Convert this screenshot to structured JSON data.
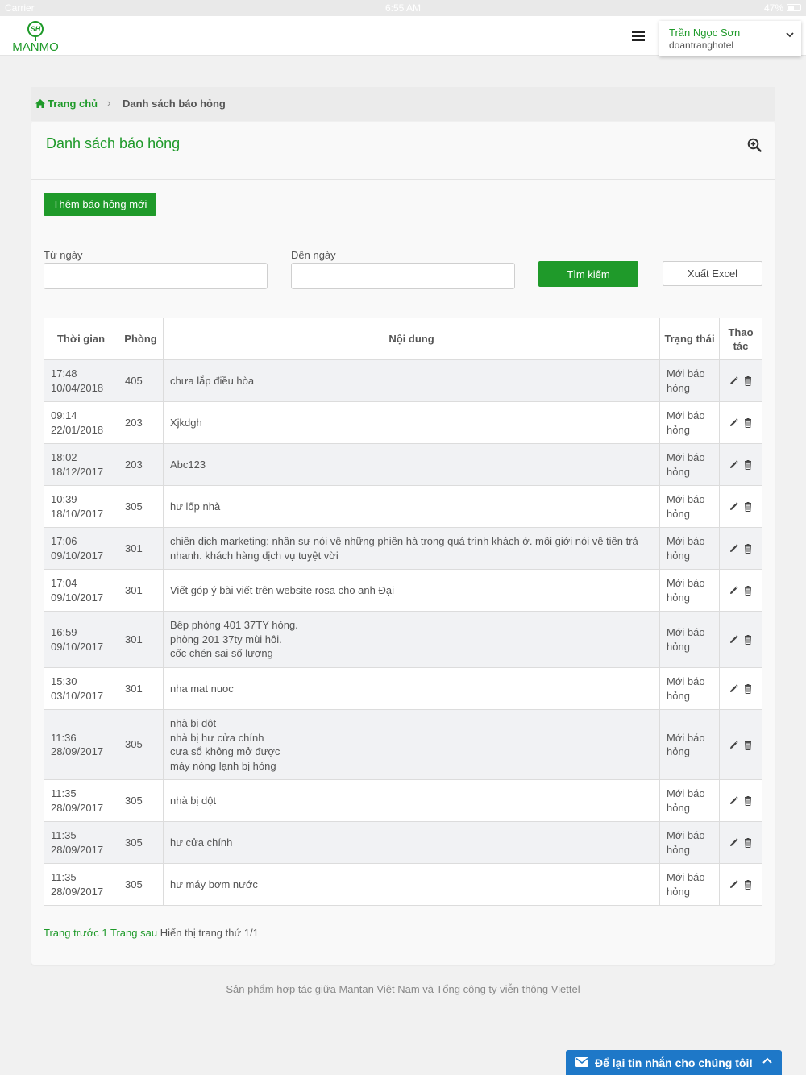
{
  "statusbar": {
    "carrier": "Carrier",
    "time": "6:55 AM",
    "battery": "47%"
  },
  "header": {
    "logo_text": "MANMO",
    "logo_mark": "SH",
    "user_name": "Trần Ngọc Sơn",
    "user_account": "doantranghotel"
  },
  "breadcrumb": {
    "home": "Trang chủ",
    "separator": "›",
    "current": "Danh sách báo hỏng"
  },
  "page": {
    "title": "Danh sách báo hỏng"
  },
  "toolbar": {
    "add_label": "Thêm báo hỏng mới"
  },
  "filters": {
    "from_label": "Từ ngày",
    "from_value": "",
    "to_label": "Đến ngày",
    "to_value": "",
    "search_label": "Tìm kiếm",
    "export_label": "Xuất Excel"
  },
  "table": {
    "headers": {
      "time": "Thời gian",
      "room": "Phòng",
      "content": "Nội dung",
      "status": "Trạng thái",
      "actions": "Thao tác"
    },
    "rows": [
      {
        "time": "17:48",
        "date": "10/04/2018",
        "room": "405",
        "content": [
          "chưa lắp điều hòa"
        ],
        "status": "Mới báo hỏng"
      },
      {
        "time": "09:14",
        "date": "22/01/2018",
        "room": "203",
        "content": [
          "Xjkdgh"
        ],
        "status": "Mới báo hỏng"
      },
      {
        "time": "18:02",
        "date": "18/12/2017",
        "room": "203",
        "content": [
          "Abc123"
        ],
        "status": "Mới báo hỏng"
      },
      {
        "time": "10:39",
        "date": "18/10/2017",
        "room": "305",
        "content": [
          "hư lốp nhà"
        ],
        "status": "Mới báo hỏng"
      },
      {
        "time": "17:06",
        "date": "09/10/2017",
        "room": "301",
        "content": [
          "chiến dịch marketing: nhân sự nói về những phiền hà trong quá trình khách ở. môi giới nói về tiền trả nhanh. khách hàng dịch vụ tuyệt vời"
        ],
        "status": "Mới báo hỏng"
      },
      {
        "time": "17:04",
        "date": "09/10/2017",
        "room": "301",
        "content": [
          "Viết góp ý bài viết trên website rosa cho anh Đại"
        ],
        "status": "Mới báo hỏng"
      },
      {
        "time": "16:59",
        "date": "09/10/2017",
        "room": "301",
        "content": [
          "Bếp phòng 401 37TY hỏng.",
          "phòng 201 37ty mùi hôi.",
          "cốc chén sai số lượng"
        ],
        "status": "Mới báo hỏng"
      },
      {
        "time": "15:30",
        "date": "03/10/2017",
        "room": "301",
        "content": [
          "nha mat nuoc"
        ],
        "status": "Mới báo hỏng"
      },
      {
        "time": "11:36",
        "date": "28/09/2017",
        "room": "305",
        "content": [
          "nhà bị dột",
          "nhà bị hư cửa chính",
          "cưa sổ không mở được",
          "máy nóng lạnh bị hỏng"
        ],
        "status": "Mới báo hỏng"
      },
      {
        "time": "11:35",
        "date": "28/09/2017",
        "room": "305",
        "content": [
          "nhà bị dột"
        ],
        "status": "Mới báo hỏng"
      },
      {
        "time": "11:35",
        "date": "28/09/2017",
        "room": "305",
        "content": [
          "hư cửa chính"
        ],
        "status": "Mới báo hỏng"
      },
      {
        "time": "11:35",
        "date": "28/09/2017",
        "room": "305",
        "content": [
          "hư máy bơm nước"
        ],
        "status": "Mới báo hỏng"
      }
    ],
    "row_icons": [
      "pencil-icon",
      "trash-icon"
    ]
  },
  "pagination": {
    "prev": "Trang trước",
    "page": "1",
    "next": "Trang sau",
    "info": "Hiển thị trang thứ 1/1"
  },
  "footer": {
    "text": "Sản phẩm hợp tác giữa Mantan Việt Nam và Tổng công ty viễn thông Viettel"
  },
  "chat": {
    "label": "Để lại tin nhắn cho chúng tôi!"
  },
  "colors": {
    "brand_green": "#1f9a2a",
    "chat_blue": "#1e78c8"
  }
}
